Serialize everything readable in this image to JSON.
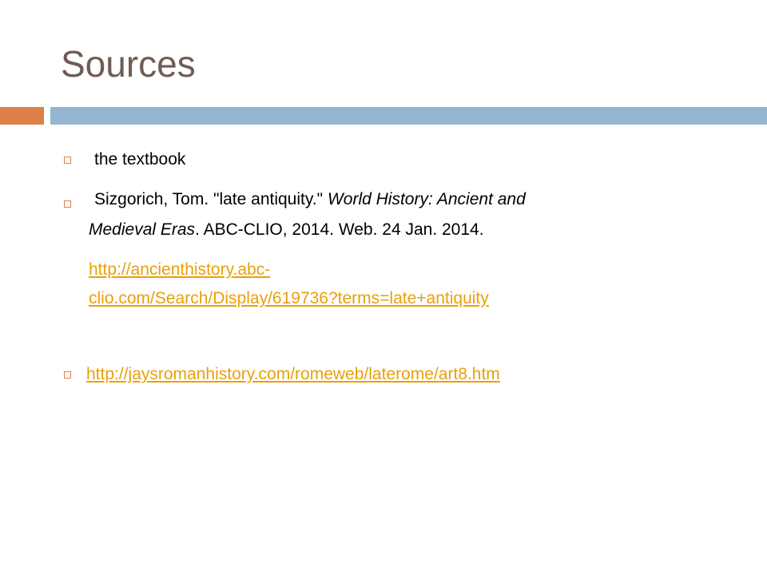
{
  "slide": {
    "title": "Sources"
  },
  "bullets": {
    "item1": "the textbook",
    "item2": {
      "prefix": "Sizgorich, Tom. \"late antiquity.\"",
      "italic1": "World History: Ancient and",
      "italic2": "Medieval Eras",
      "suffix": ". ABC-CLIO, 2014. Web. 24 Jan. 2014.",
      "link_line1": "http://ancienthistory.abc-",
      "link_line2": "clio.com/Search/Display/619736?terms=late+antiquity"
    },
    "item3": {
      "link": "http://jaysromanhistory.com/romeweb/laterome/art8.htm"
    }
  },
  "colors": {
    "title": "#705c53",
    "accent_orange": "#dd8047",
    "accent_blue": "#94b6d2",
    "link": "#e8a00c"
  }
}
